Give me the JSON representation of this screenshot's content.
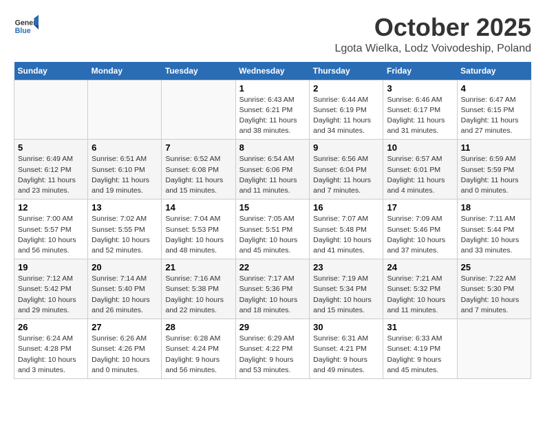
{
  "header": {
    "logo_line1": "General",
    "logo_line2": "Blue",
    "title": "October 2025",
    "subtitle": "Lgota Wielka, Lodz Voivodeship, Poland"
  },
  "days_of_week": [
    "Sunday",
    "Monday",
    "Tuesday",
    "Wednesday",
    "Thursday",
    "Friday",
    "Saturday"
  ],
  "weeks": [
    [
      {
        "day": "",
        "info": ""
      },
      {
        "day": "",
        "info": ""
      },
      {
        "day": "",
        "info": ""
      },
      {
        "day": "1",
        "info": "Sunrise: 6:43 AM\nSunset: 6:21 PM\nDaylight: 11 hours and 38 minutes."
      },
      {
        "day": "2",
        "info": "Sunrise: 6:44 AM\nSunset: 6:19 PM\nDaylight: 11 hours and 34 minutes."
      },
      {
        "day": "3",
        "info": "Sunrise: 6:46 AM\nSunset: 6:17 PM\nDaylight: 11 hours and 31 minutes."
      },
      {
        "day": "4",
        "info": "Sunrise: 6:47 AM\nSunset: 6:15 PM\nDaylight: 11 hours and 27 minutes."
      }
    ],
    [
      {
        "day": "5",
        "info": "Sunrise: 6:49 AM\nSunset: 6:12 PM\nDaylight: 11 hours and 23 minutes."
      },
      {
        "day": "6",
        "info": "Sunrise: 6:51 AM\nSunset: 6:10 PM\nDaylight: 11 hours and 19 minutes."
      },
      {
        "day": "7",
        "info": "Sunrise: 6:52 AM\nSunset: 6:08 PM\nDaylight: 11 hours and 15 minutes."
      },
      {
        "day": "8",
        "info": "Sunrise: 6:54 AM\nSunset: 6:06 PM\nDaylight: 11 hours and 11 minutes."
      },
      {
        "day": "9",
        "info": "Sunrise: 6:56 AM\nSunset: 6:04 PM\nDaylight: 11 hours and 7 minutes."
      },
      {
        "day": "10",
        "info": "Sunrise: 6:57 AM\nSunset: 6:01 PM\nDaylight: 11 hours and 4 minutes."
      },
      {
        "day": "11",
        "info": "Sunrise: 6:59 AM\nSunset: 5:59 PM\nDaylight: 11 hours and 0 minutes."
      }
    ],
    [
      {
        "day": "12",
        "info": "Sunrise: 7:00 AM\nSunset: 5:57 PM\nDaylight: 10 hours and 56 minutes."
      },
      {
        "day": "13",
        "info": "Sunrise: 7:02 AM\nSunset: 5:55 PM\nDaylight: 10 hours and 52 minutes."
      },
      {
        "day": "14",
        "info": "Sunrise: 7:04 AM\nSunset: 5:53 PM\nDaylight: 10 hours and 48 minutes."
      },
      {
        "day": "15",
        "info": "Sunrise: 7:05 AM\nSunset: 5:51 PM\nDaylight: 10 hours and 45 minutes."
      },
      {
        "day": "16",
        "info": "Sunrise: 7:07 AM\nSunset: 5:48 PM\nDaylight: 10 hours and 41 minutes."
      },
      {
        "day": "17",
        "info": "Sunrise: 7:09 AM\nSunset: 5:46 PM\nDaylight: 10 hours and 37 minutes."
      },
      {
        "day": "18",
        "info": "Sunrise: 7:11 AM\nSunset: 5:44 PM\nDaylight: 10 hours and 33 minutes."
      }
    ],
    [
      {
        "day": "19",
        "info": "Sunrise: 7:12 AM\nSunset: 5:42 PM\nDaylight: 10 hours and 29 minutes."
      },
      {
        "day": "20",
        "info": "Sunrise: 7:14 AM\nSunset: 5:40 PM\nDaylight: 10 hours and 26 minutes."
      },
      {
        "day": "21",
        "info": "Sunrise: 7:16 AM\nSunset: 5:38 PM\nDaylight: 10 hours and 22 minutes."
      },
      {
        "day": "22",
        "info": "Sunrise: 7:17 AM\nSunset: 5:36 PM\nDaylight: 10 hours and 18 minutes."
      },
      {
        "day": "23",
        "info": "Sunrise: 7:19 AM\nSunset: 5:34 PM\nDaylight: 10 hours and 15 minutes."
      },
      {
        "day": "24",
        "info": "Sunrise: 7:21 AM\nSunset: 5:32 PM\nDaylight: 10 hours and 11 minutes."
      },
      {
        "day": "25",
        "info": "Sunrise: 7:22 AM\nSunset: 5:30 PM\nDaylight: 10 hours and 7 minutes."
      }
    ],
    [
      {
        "day": "26",
        "info": "Sunrise: 6:24 AM\nSunset: 4:28 PM\nDaylight: 10 hours and 3 minutes."
      },
      {
        "day": "27",
        "info": "Sunrise: 6:26 AM\nSunset: 4:26 PM\nDaylight: 10 hours and 0 minutes."
      },
      {
        "day": "28",
        "info": "Sunrise: 6:28 AM\nSunset: 4:24 PM\nDaylight: 9 hours and 56 minutes."
      },
      {
        "day": "29",
        "info": "Sunrise: 6:29 AM\nSunset: 4:22 PM\nDaylight: 9 hours and 53 minutes."
      },
      {
        "day": "30",
        "info": "Sunrise: 6:31 AM\nSunset: 4:21 PM\nDaylight: 9 hours and 49 minutes."
      },
      {
        "day": "31",
        "info": "Sunrise: 6:33 AM\nSunset: 4:19 PM\nDaylight: 9 hours and 45 minutes."
      },
      {
        "day": "",
        "info": ""
      }
    ]
  ]
}
